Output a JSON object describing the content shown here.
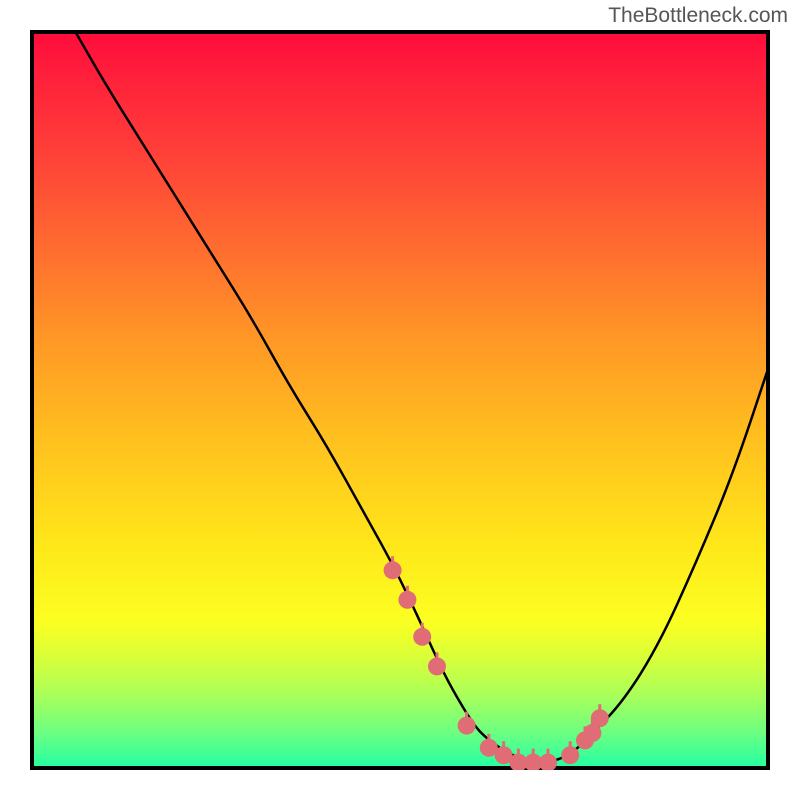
{
  "watermark": "TheBottleneck.com",
  "chart_data": {
    "type": "line",
    "title": "",
    "xlabel": "",
    "ylabel": "",
    "xlim": [
      0,
      100
    ],
    "ylim": [
      0,
      100
    ],
    "grid": false,
    "legend": null,
    "background_gradient": {
      "top_color": "#ff0b3b",
      "bottom_color": "#1fffa4",
      "description": "red at top → green at bottom (bottleneck severity)"
    },
    "series": [
      {
        "name": "bottleneck-curve",
        "color": "#000000",
        "x": [
          6,
          10,
          15,
          20,
          25,
          30,
          35,
          40,
          45,
          50,
          55,
          57,
          60,
          62,
          65,
          68,
          70,
          73,
          75,
          80,
          85,
          90,
          95,
          100
        ],
        "y": [
          100,
          93,
          85,
          77,
          69,
          61,
          52,
          44,
          35,
          26,
          15,
          11,
          6,
          4,
          2,
          1,
          1,
          2,
          4,
          9,
          17,
          28,
          40,
          55
        ]
      },
      {
        "name": "highlight-dots",
        "type": "scatter",
        "color": "#e06c75",
        "x": [
          49,
          51,
          53,
          55,
          59,
          62,
          64,
          66,
          68,
          70,
          73,
          75,
          76,
          77
        ],
        "y": [
          27,
          23,
          18,
          14,
          6,
          3,
          2,
          1,
          1,
          1,
          2,
          4,
          5,
          7
        ]
      }
    ]
  }
}
